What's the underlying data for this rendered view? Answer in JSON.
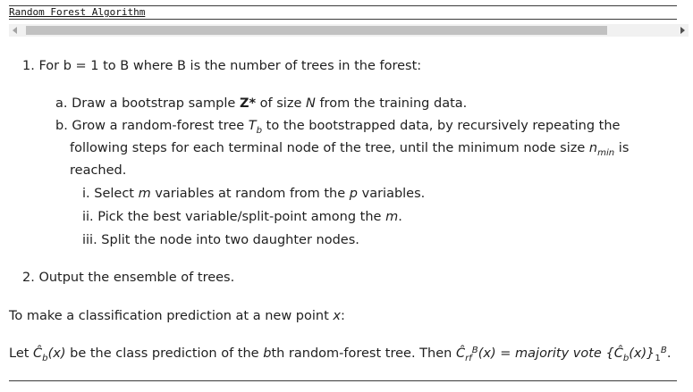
{
  "header": {
    "title": "Random Forest Algorithm"
  },
  "step1": {
    "text": "1. For b = 1 to B where B is the number of trees in the forest:",
    "a": {
      "pre": "a. Draw a bootstrap sample ",
      "bold": "Z*",
      "mid": " of size ",
      "N": "N",
      "post": " from the training data."
    },
    "b": {
      "line1_pre": "b. Grow a random-forest tree ",
      "T": "T",
      "sub": "b",
      "line1_post": " to the bootstrapped data, by recursively repeating the",
      "line2_pre": "following steps for each terminal node of the tree, until the minimum node size ",
      "n": "n",
      "nsub": "min",
      "line2_post": " is",
      "line3": "reached."
    },
    "i": {
      "pre": "i. Select ",
      "m": "m",
      "mid": " variables at random from the ",
      "p": "p",
      "post": " variables."
    },
    "ii": {
      "pre": "ii. Pick the best variable/split-point among the ",
      "m": "m",
      "post": "."
    },
    "iii": {
      "text": "iii. Split the node into two daughter nodes."
    }
  },
  "step2": {
    "text": "2. Output the ensemble of trees."
  },
  "para1": {
    "pre": "To make a classification prediction at a new point ",
    "x": "x",
    "post": ":"
  },
  "para2": {
    "pre": "Let ",
    "c1": "Ĉ",
    "c1sub": "b",
    "c1arg": "(x)",
    "mid": " be the class prediction of the ",
    "b": "b",
    "mid2": "th random-forest tree. Then ",
    "c2": "Ĉ",
    "c2sub": "rf",
    "c2sup": "B",
    "c2arg": "(x)",
    "rest": " = majority vote {",
    "c3": "Ĉ",
    "c3sub": "b",
    "c3arg": "(x)",
    "close": "}",
    "sub1": "1",
    "supB": "B",
    "end": "."
  }
}
